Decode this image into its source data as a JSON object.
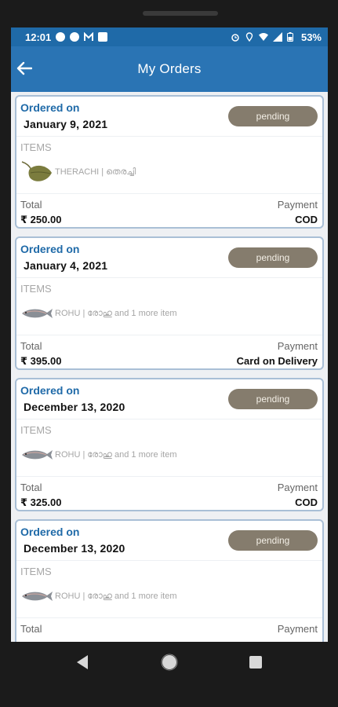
{
  "status_bar": {
    "time": "12:01",
    "battery": "53%",
    "left_icons": [
      "whatsapp-icon",
      "notification-icon",
      "gmail-icon",
      "app-icon"
    ],
    "right_icons": [
      "alarm-icon",
      "location-icon",
      "wifi-icon",
      "signal-icon",
      "battery-icon"
    ]
  },
  "appbar": {
    "title": "My Orders",
    "back_icon": "arrow-left-icon"
  },
  "labels": {
    "ordered_on": "Ordered on",
    "items": "ITEMS",
    "total": "Total",
    "payment": "Payment"
  },
  "orders": [
    {
      "date": "January 9, 2021",
      "status": "pending",
      "item_text": "THERACHI | തെരച്ചി",
      "thumb": "leaf-fish-icon",
      "total": "₹ 250.00",
      "payment": "COD"
    },
    {
      "date": "January 4, 2021",
      "status": "pending",
      "item_text": "ROHU | രോഹു and 1 more item",
      "thumb": "fish-icon",
      "total": "₹ 395.00",
      "payment": "Card on Delivery"
    },
    {
      "date": "December 13, 2020",
      "status": "pending",
      "item_text": "ROHU | രോഹു and 1 more item",
      "thumb": "fish-icon",
      "total": "₹ 325.00",
      "payment": "COD"
    },
    {
      "date": "December 13, 2020",
      "status": "pending",
      "item_text": "ROHU | രോഹു and 1 more item",
      "thumb": "fish-icon",
      "total": "",
      "payment": ""
    }
  ],
  "nav": {
    "back": "nav-back-icon",
    "home": "nav-home-icon",
    "recents": "nav-recents-icon"
  },
  "colors": {
    "status_bar": "#1f6aa8",
    "app_bar": "#2a74b4",
    "accent_text": "#1f6aa8",
    "badge": "#857c6d",
    "card_border": "#a9bfd6"
  }
}
